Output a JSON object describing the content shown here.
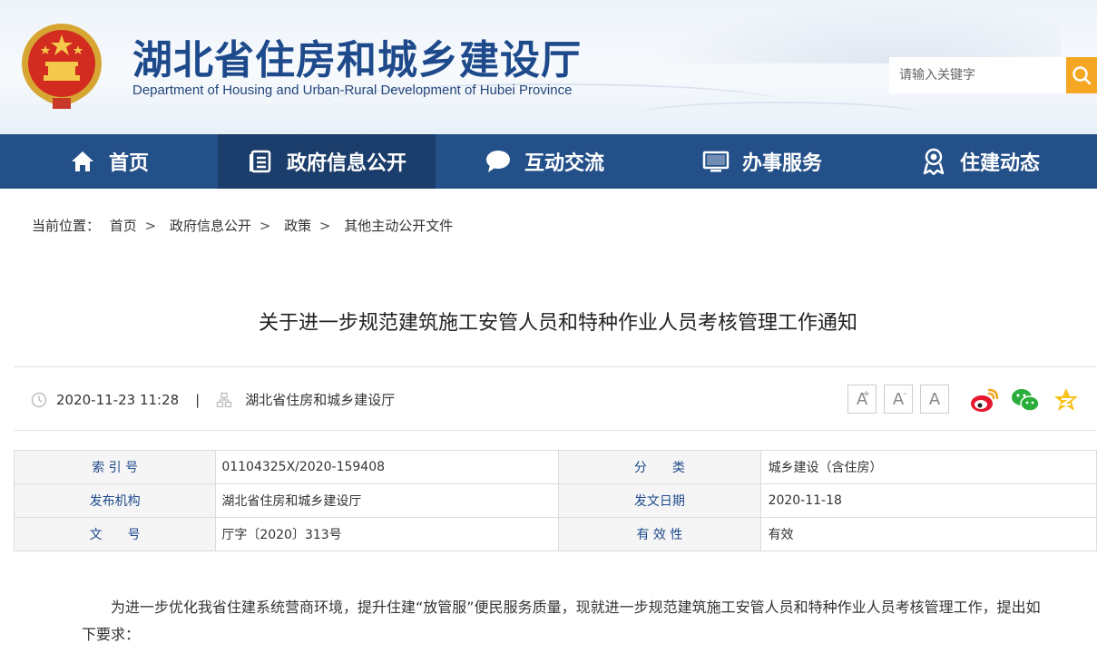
{
  "header": {
    "title": "湖北省住房和城乡建设厅",
    "subtitle": "Department of Housing and Urban-Rural Development of Hubei Province",
    "search_placeholder": "请输入关键字"
  },
  "nav": {
    "items": [
      {
        "label": "首页",
        "icon": "home-icon"
      },
      {
        "label": "政府信息公开",
        "icon": "document-list-icon",
        "active": true
      },
      {
        "label": "互动交流",
        "icon": "chat-bubble-icon"
      },
      {
        "label": "办事服务",
        "icon": "monitor-icon"
      },
      {
        "label": "住建动态",
        "icon": "badge-person-icon"
      }
    ]
  },
  "breadcrumb": {
    "prefix": "当前位置：",
    "items": [
      "首页",
      "政府信息公开",
      "政策",
      "其他主动公开文件"
    ],
    "separator": ">"
  },
  "article": {
    "title": "关于进一步规范建筑施工安管人员和特种作业人员考核管理工作通知",
    "date": "2020-11-23 11:28",
    "pipe": "|",
    "source": "湖北省住房和城乡建设厅",
    "font_buttons": [
      "A",
      "A",
      "A"
    ],
    "font_button_marks": [
      "+",
      "-"
    ],
    "share": [
      "weibo-icon",
      "wechat-icon",
      "qzone-icon"
    ],
    "info": {
      "index_label": "索 引 号",
      "index_value": "01104325X/2020-159408",
      "category_label": "分　　类",
      "category_value": "城乡建设（含住房）",
      "publisher_label": "发布机构",
      "publisher_value": "湖北省住房和城乡建设厅",
      "date_label": "发文日期",
      "date_value": "2020-11-18",
      "docno_label": "文　　号",
      "docno_value": "厅字〔2020〕313号",
      "validity_label": "有 效 性",
      "validity_value": "有效"
    },
    "body": "为进一步优化我省住建系统营商环境，提升住建“放管服”便民服务质量，现就进一步规范建筑施工安管人员和特种作业人员考核管理工作，提出如下要求："
  },
  "colors": {
    "nav_bg": "#245089",
    "nav_active": "#1b3d6b",
    "title_blue": "#1e4a8c",
    "search_btn": "#f5a623"
  }
}
